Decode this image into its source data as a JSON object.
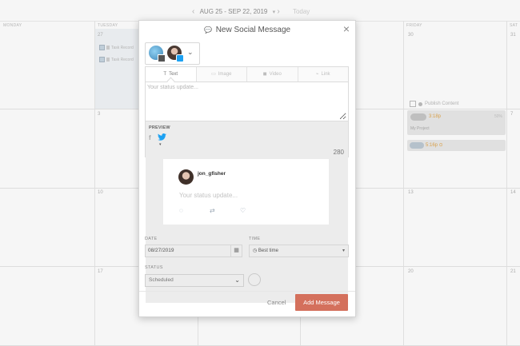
{
  "calendar": {
    "date_range": "AUG 25 - SEP 22, 2019",
    "today_label": "Today",
    "day_names": [
      "MONDAY",
      "TUESDAY",
      "FRIDAY",
      "SAT"
    ],
    "numbers_row1": [
      "27",
      "30",
      "31"
    ],
    "numbers_row2": [
      "3",
      "6",
      "7"
    ],
    "numbers_row3": [
      "10",
      "13",
      "14"
    ],
    "numbers_row4": [
      "17",
      "20",
      "21"
    ],
    "tasks": [
      "Task Record",
      "Task Record"
    ],
    "publish_content": "Publish Content",
    "card1": {
      "time": "3:18p",
      "status": "50%",
      "project": "My Project"
    },
    "card2": {
      "time": "5:16p ⊙"
    }
  },
  "modal": {
    "title": "New Social Message",
    "tabs": [
      {
        "label": "Text",
        "icon": "T"
      },
      {
        "label": "Image",
        "icon": "▭"
      },
      {
        "label": "Video",
        "icon": "◼"
      },
      {
        "label": "Link",
        "icon": "⌁"
      }
    ],
    "status_placeholder": "Your status update...",
    "preview_label": "PREVIEW",
    "char_count": "280",
    "tweet": {
      "username": "jon_gfisher",
      "text": "Your status update..."
    },
    "date_label": "DATE",
    "date_value": "08/27/2019",
    "time_label": "TIME",
    "time_value": "Best time",
    "status_label": "STATUS",
    "status_value": "Scheduled",
    "cancel_label": "Cancel",
    "add_label": "Add Message"
  },
  "colors": {
    "accent": "#d4705c",
    "twitter": "#1da1f2",
    "time_orange": "#e0a64d"
  }
}
